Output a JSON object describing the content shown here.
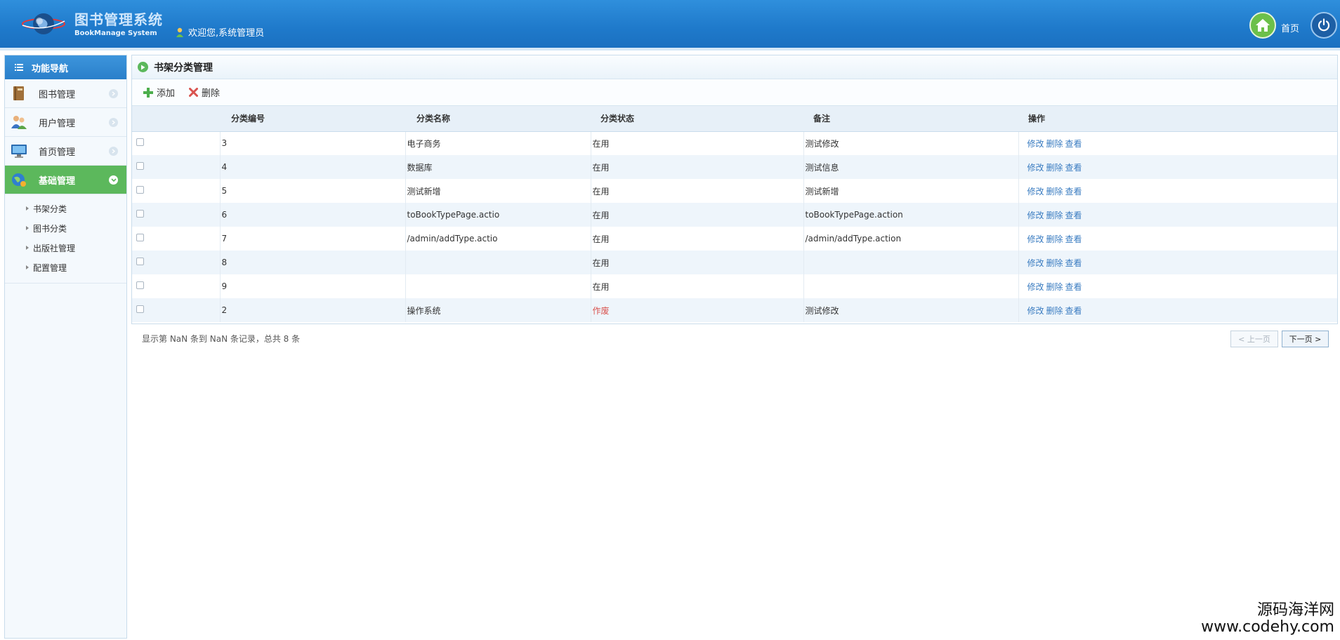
{
  "header": {
    "app_title": "图书管理系统",
    "app_subtitle": "BookManage System",
    "welcome": "欢迎您,系统管理员",
    "home_label": "首页"
  },
  "sidebar": {
    "title": "功能导航",
    "items": [
      {
        "label": "图书管理",
        "icon": "book-icon"
      },
      {
        "label": "用户管理",
        "icon": "users-icon"
      },
      {
        "label": "首页管理",
        "icon": "monitor-icon"
      },
      {
        "label": "基础管理",
        "icon": "globe-icon",
        "active": true
      }
    ],
    "sub_items": [
      "书架分类",
      "图书分类",
      "出版社管理",
      "配置管理"
    ]
  },
  "panel": {
    "title": "书架分类管理",
    "toolbar": {
      "add_label": "添加",
      "delete_label": "删除"
    },
    "columns": [
      "分类编号",
      "分类名称",
      "分类状态",
      "备注",
      "操作"
    ],
    "rows": [
      {
        "id": "3",
        "name": "电子商务",
        "status": "在用",
        "remark": "测试修改"
      },
      {
        "id": "4",
        "name": "数据库",
        "status": "在用",
        "remark": "测试信息"
      },
      {
        "id": "5",
        "name": "测试新增",
        "status": "在用",
        "remark": "测试新增"
      },
      {
        "id": "6",
        "name": "toBookTypePage.actio",
        "status": "在用",
        "remark": "toBookTypePage.action"
      },
      {
        "id": "7",
        "name": "/admin/addType.actio",
        "status": "在用",
        "remark": "/admin/addType.action"
      },
      {
        "id": "8",
        "name": "",
        "status": "在用",
        "remark": ""
      },
      {
        "id": "9",
        "name": "",
        "status": "在用",
        "remark": ""
      },
      {
        "id": "2",
        "name": "操作系统",
        "status": "作废",
        "remark": "测试修改"
      }
    ],
    "ops": {
      "edit": "修改",
      "delete": "删除",
      "view": "查看"
    }
  },
  "pagination": {
    "info": "显示第 NaN 条到 NaN 条记录，总共 8 条",
    "prev": "< 上一页",
    "next": "下一页 >"
  },
  "watermark": {
    "line1": "源码海洋网",
    "line2": "www.codehy.com"
  },
  "colors": {
    "header_blue": "#1f7acb",
    "active_green": "#5cb85c",
    "void_red": "#d9534f",
    "link_blue": "#3a7cc1"
  }
}
